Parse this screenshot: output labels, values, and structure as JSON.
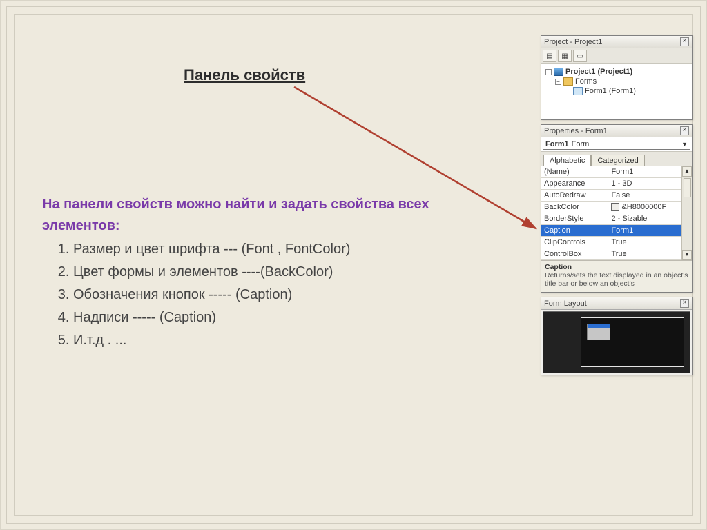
{
  "title": "Панель свойств",
  "intro": "На панели свойств можно найти и задать свойства всех элементов:",
  "items": [
    "Размер и цвет шрифта        --- (Font , FontColor)",
    "Цвет формы и элементов            ----(BackColor)",
    "Обозначения кнопок                    ----- (Caption)",
    "Надписи                                        ----- (Caption)",
    "И.т.д . ..."
  ],
  "project_pane": {
    "title": "Project - Project1",
    "root": "Project1 (Project1)",
    "folder": "Forms",
    "form": "Form1 (Form1)"
  },
  "properties_pane": {
    "title": "Properties - Form1",
    "object_name": "Form1",
    "object_type": "Form",
    "tabs": {
      "alpha": "Alphabetic",
      "cat": "Categorized"
    },
    "rows": [
      {
        "name": "(Name)",
        "value": "Form1"
      },
      {
        "name": "Appearance",
        "value": "1 - 3D"
      },
      {
        "name": "AutoRedraw",
        "value": "False"
      },
      {
        "name": "BackColor",
        "value": "&H8000000F",
        "swatch": true
      },
      {
        "name": "BorderStyle",
        "value": "2 - Sizable"
      },
      {
        "name": "Caption",
        "value": "Form1",
        "selected": true
      },
      {
        "name": "ClipControls",
        "value": "True"
      },
      {
        "name": "ControlBox",
        "value": "True"
      }
    ],
    "desc_title": "Caption",
    "desc_text": "Returns/sets the text displayed in an object's title bar or below an object's"
  },
  "layout_pane": {
    "title": "Form Layout"
  }
}
